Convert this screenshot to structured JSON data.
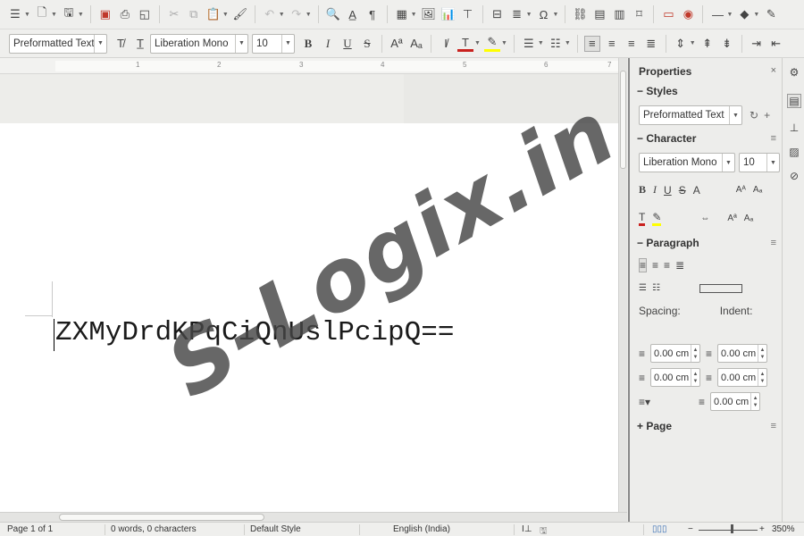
{
  "toolbar_standard": {
    "icons": [
      "sidebar-toggle-icon",
      "new-document-icon",
      "open-icon",
      "save-icon",
      "export-pdf-icon",
      "print-icon",
      "print-preview-icon",
      "cut-icon",
      "copy-icon",
      "paste-icon",
      "clone-formatting-icon",
      "undo-icon",
      "redo-icon",
      "find-replace-icon",
      "spelling-icon",
      "formatting-marks-icon",
      "insert-table-icon",
      "insert-image-icon",
      "insert-chart-icon",
      "insert-textbox-icon",
      "page-break-icon",
      "insert-field-icon",
      "special-character-icon",
      "hyperlink-icon",
      "footnote-icon",
      "comment-icon",
      "track-changes-icon",
      "insert-line-icon",
      "basic-shapes-icon",
      "draw-functions-icon"
    ]
  },
  "toolbar_formatting": {
    "paragraph_style": "Preformatted Text",
    "font_name": "Liberation Mono",
    "font_size": "10",
    "bold_label": "B",
    "italic_label": "I",
    "underline_label": "U",
    "strikethrough_label": "S"
  },
  "ruler": {
    "numbers": [
      "1",
      "2",
      "3",
      "4",
      "5",
      "6",
      "7"
    ]
  },
  "document": {
    "text": "ZXMyDrdKPqCiQnUslPcipQ=="
  },
  "watermark": {
    "text": "S-Logix.in"
  },
  "sidebar": {
    "title": "Properties",
    "close_label": "×",
    "styles_header": "Styles",
    "styles_value": "Preformatted Text",
    "character_header": "Character",
    "font_name": "Liberation Mono",
    "font_size": "10",
    "paragraph_header": "Paragraph",
    "spacing_label": "Spacing:",
    "indent_label": "Indent:",
    "spacing_above": "0.00 cm",
    "spacing_below": "0.00 cm",
    "indent_before": "0.00 cm",
    "indent_after": "0.00 cm",
    "indent_first": "0.00 cm",
    "page_header": "Page",
    "collapse_glyph": "−",
    "expand_glyph": "+",
    "menu_glyph": "≡"
  },
  "statusbar": {
    "page": "Page 1 of 1",
    "words": "0 words, 0 characters",
    "page_style": "Default Style",
    "language": "English (India)",
    "zoom": "350%"
  },
  "colors": {
    "font_color_bar": "#c9211e",
    "highlight_bar": "#ffff00"
  }
}
